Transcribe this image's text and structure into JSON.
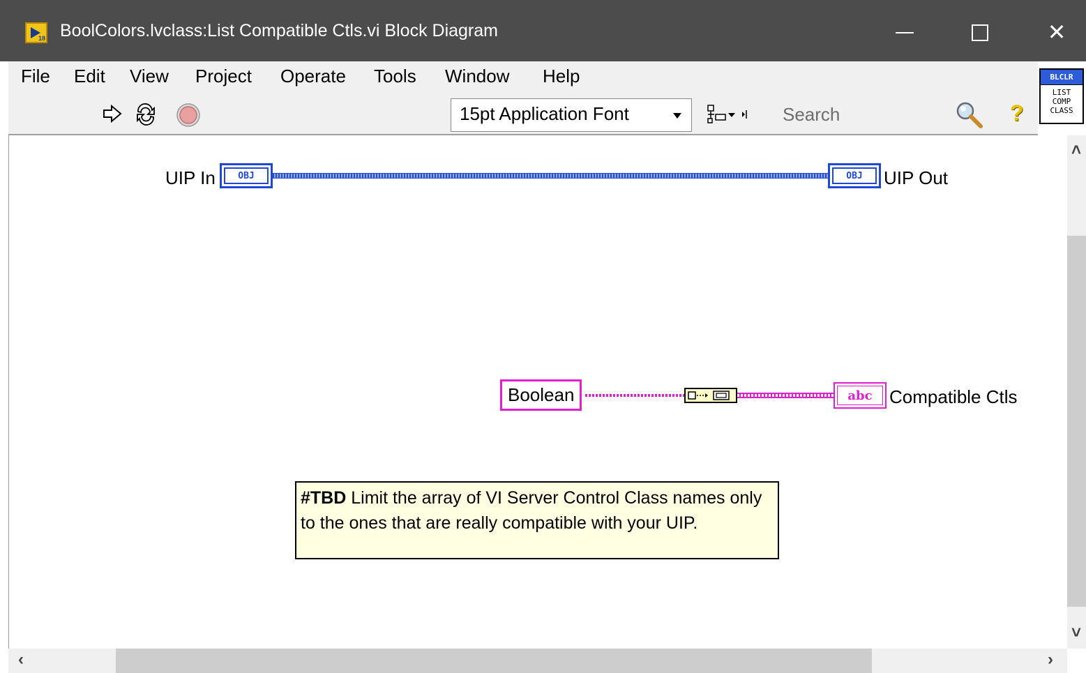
{
  "window": {
    "title": "BoolColors.lvclass:List Compatible Ctls.vi Block Diagram",
    "app_icon_version": "18"
  },
  "menu": {
    "items": [
      "File",
      "Edit",
      "View",
      "Project",
      "Operate",
      "Tools",
      "Window",
      "Help"
    ]
  },
  "toolbar": {
    "font_select": "15pt Application Font",
    "search_placeholder": "Search"
  },
  "vi_icon": {
    "header": "BLCLR",
    "lines": [
      "LIST",
      "COMP",
      "CLASS"
    ]
  },
  "diagram": {
    "uip_in_label": "UIP In",
    "uip_out_label": "UIP Out",
    "obj_terminal_text": "OBJ",
    "boolean_constant": "Boolean",
    "string_terminal_text": "abc",
    "compatible_ctls_label": "Compatible Ctls",
    "comment_tag": "#TBD",
    "comment_text": " Limit the array of VI Server Control Class names only to the ones that are really compatible with your UIP."
  },
  "colors": {
    "class_wire": "#1e49d8",
    "string_wire": "#e020d0",
    "comment_bg": "#ffffe1",
    "titlebar": "#4c4c4c"
  }
}
